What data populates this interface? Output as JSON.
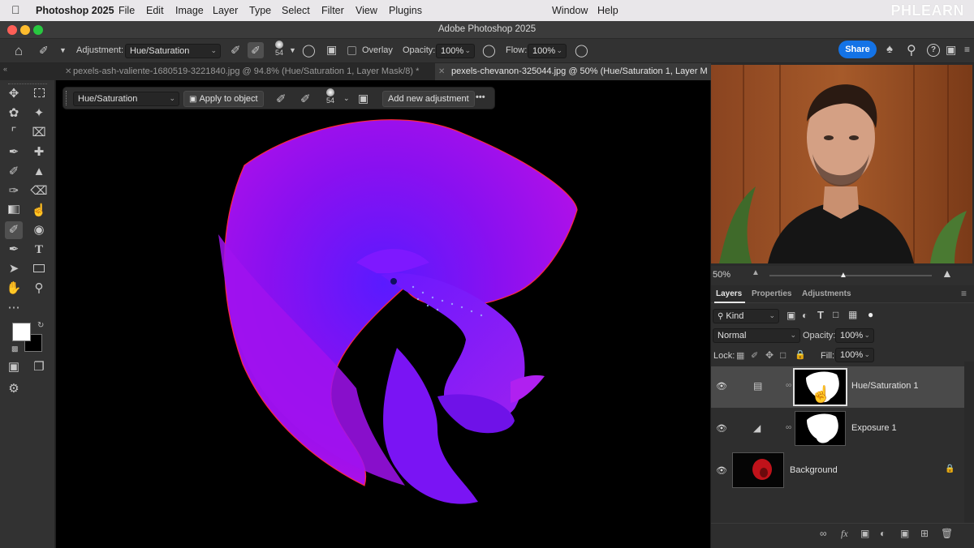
{
  "menubar": {
    "app": "Photoshop 2025",
    "items": [
      "File",
      "Edit",
      "Image",
      "Layer",
      "Type",
      "Select",
      "Filter",
      "View",
      "Plugins",
      "Window",
      "Help"
    ],
    "watermark": "PHLEARN"
  },
  "window": {
    "title": "Adobe Photoshop 2025"
  },
  "options": {
    "adjustment_label": "Adjustment:",
    "adjustment_value": "Hue/Saturation",
    "brush_size": "54",
    "overlay_label": "Overlay",
    "opacity_label": "Opacity:",
    "opacity_value": "100%",
    "flow_label": "Flow:",
    "flow_value": "100%",
    "share_label": "Share"
  },
  "tabs": [
    {
      "label": "pexels-ash-valiente-1680519-3221840.jpg @ 94.8% (Hue/Saturation 1, Layer Mask/8) *",
      "active": false
    },
    {
      "label": "pexels-chevanon-325044.jpg @ 50% (Hue/Saturation 1, Layer M",
      "active": true
    }
  ],
  "contextbar": {
    "adjustment_value": "Hue/Saturation",
    "apply_label": "Apply to object",
    "brush_size": "54",
    "add_label": "Add new adjustment",
    "more_label": "•••"
  },
  "navigator": {
    "zoom": "50%"
  },
  "panels": {
    "tabs": [
      "Layers",
      "Properties",
      "Adjustments"
    ],
    "filter_kind": "Kind",
    "blend_mode": "Normal",
    "opacity_label": "Opacity:",
    "opacity_value": "100%",
    "lock_label": "Lock:",
    "fill_label": "Fill:",
    "fill_value": "100%",
    "layers": [
      {
        "name": "Hue/Saturation 1",
        "type": "adjustment",
        "selected": true
      },
      {
        "name": "Exposure 1",
        "type": "adjustment",
        "selected": false
      },
      {
        "name": "Background",
        "type": "pixel",
        "selected": false,
        "locked": true
      }
    ]
  },
  "colors": {
    "accent": "#1473e6",
    "fish": "#8a10f0",
    "selected_row": "#4a4a4a"
  }
}
